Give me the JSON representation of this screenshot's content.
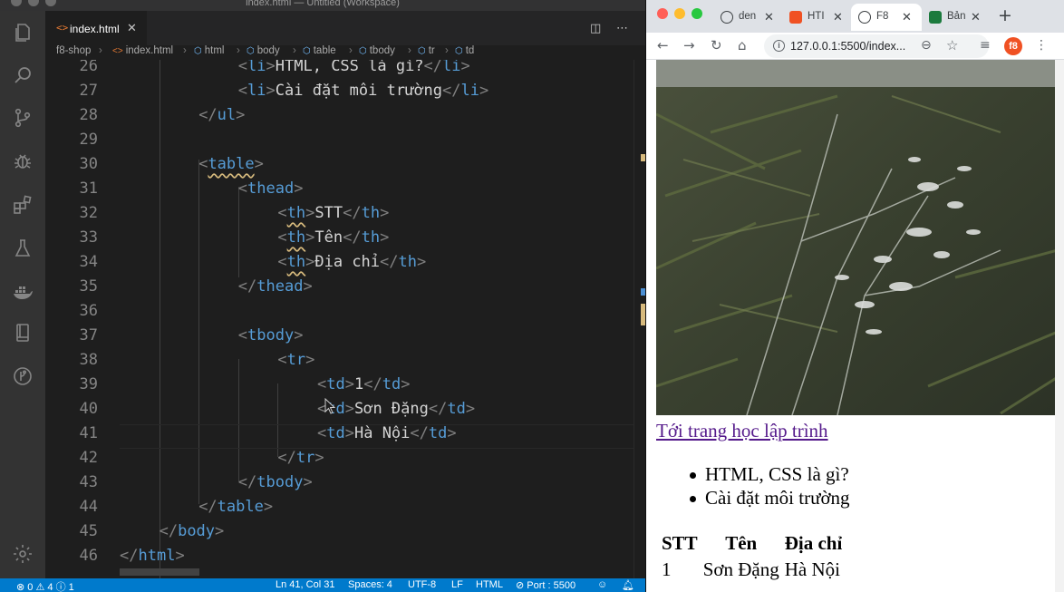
{
  "vscode": {
    "window_title": "index.html — Untitled (Workspace)",
    "tab": {
      "label": "index.html",
      "icon": "<>"
    },
    "breadcrumb": [
      "f8-shop",
      "index.html",
      "html",
      "body",
      "table",
      "tbody",
      "tr",
      "td"
    ],
    "lines": [
      {
        "n": "26",
        "indent": 3,
        "code": "<li>HTML, CSS là gì?</li>"
      },
      {
        "n": "27",
        "indent": 3,
        "code": "<li>Cài đặt môi trường</li>"
      },
      {
        "n": "28",
        "indent": 2,
        "code": "</ul>"
      },
      {
        "n": "29",
        "indent": 0,
        "code": ""
      },
      {
        "n": "30",
        "indent": 2,
        "code": "<table>"
      },
      {
        "n": "31",
        "indent": 3,
        "code": "<thead>"
      },
      {
        "n": "32",
        "indent": 4,
        "code": "<th>STT</th>"
      },
      {
        "n": "33",
        "indent": 4,
        "code": "<th>Tên</th>"
      },
      {
        "n": "34",
        "indent": 4,
        "code": "<th>Địa chỉ</th>"
      },
      {
        "n": "35",
        "indent": 3,
        "code": "</thead>"
      },
      {
        "n": "36",
        "indent": 0,
        "code": ""
      },
      {
        "n": "37",
        "indent": 3,
        "code": "<tbody>"
      },
      {
        "n": "38",
        "indent": 4,
        "code": "<tr>"
      },
      {
        "n": "39",
        "indent": 5,
        "code": "<td>1</td>"
      },
      {
        "n": "40",
        "indent": 5,
        "code": "<td>Sơn Đặng</td>"
      },
      {
        "n": "41",
        "indent": 5,
        "code": "<td>Hà Nội</td>"
      },
      {
        "n": "42",
        "indent": 4,
        "code": "</tr>"
      },
      {
        "n": "43",
        "indent": 3,
        "code": "</tbody>"
      },
      {
        "n": "44",
        "indent": 2,
        "code": "</table>"
      },
      {
        "n": "45",
        "indent": 1,
        "code": "</body>"
      },
      {
        "n": "46",
        "indent": 0,
        "code": "</html>"
      }
    ],
    "status": {
      "errors": "0",
      "warnings": "4",
      "info": "1",
      "position": "Ln 41, Col 31",
      "spaces": "Spaces: 4",
      "encoding": "UTF-8",
      "eol": "LF",
      "language": "HTML",
      "port": "Port : 5500"
    },
    "colors": {
      "statusbar": "#007acc",
      "tag": "#569cd6",
      "bracket": "#808080"
    }
  },
  "browser": {
    "tabs": [
      {
        "label": "den",
        "favicon": "globe-icon"
      },
      {
        "label": "HTI",
        "favicon": "f8-icon"
      },
      {
        "label": "F8",
        "favicon": "globe-icon",
        "active": true
      },
      {
        "label": "Bản",
        "favicon": "d-icon"
      }
    ],
    "url": "127.0.0.1:5500/index...",
    "page": {
      "link_text": "Tới trang học lập trình",
      "list_items": [
        "HTML, CSS là gì?",
        "Cài đặt môi trường"
      ],
      "table": {
        "headers": [
          "STT",
          "Tên",
          "Địa chỉ"
        ],
        "rows": [
          [
            "1",
            "Sơn Đặng",
            "Hà Nội"
          ]
        ]
      }
    },
    "extension_label": "f8"
  }
}
